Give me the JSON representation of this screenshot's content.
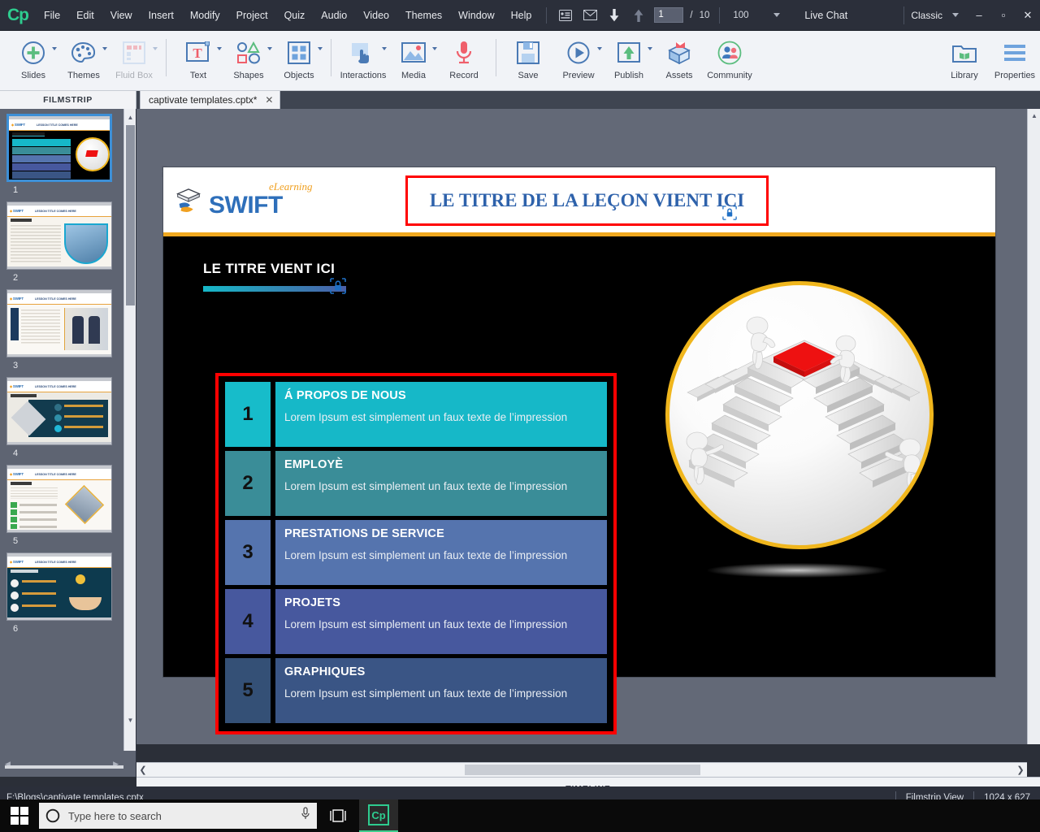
{
  "app": {
    "logo": "Cp",
    "menu_items": [
      "File",
      "Edit",
      "View",
      "Insert",
      "Modify",
      "Project",
      "Quiz",
      "Audio",
      "Video",
      "Themes",
      "Window",
      "Help"
    ],
    "slide_current": "1",
    "slide_separator": "/",
    "slide_total": "10",
    "zoom_level": "100",
    "live_chat": "Live Chat",
    "workspace": "Classic",
    "window_controls": {
      "minimize": "–",
      "maximize": "▫",
      "close": "✕"
    }
  },
  "ribbon": {
    "groups": [
      {
        "label": "Slides",
        "icon": "add-slide-icon",
        "has_chevron": true,
        "disabled": false
      },
      {
        "label": "Themes",
        "icon": "palette-icon",
        "has_chevron": true,
        "disabled": false
      },
      {
        "label": "Fluid Box",
        "icon": "fluidbox-icon",
        "has_chevron": true,
        "disabled": true
      },
      {
        "label": "Text",
        "icon": "text-icon",
        "has_chevron": true,
        "disabled": false
      },
      {
        "label": "Shapes",
        "icon": "shapes-icon",
        "has_chevron": true,
        "disabled": false
      },
      {
        "label": "Objects",
        "icon": "objects-icon",
        "has_chevron": true,
        "disabled": false
      },
      {
        "label": "Interactions",
        "icon": "interactions-icon",
        "has_chevron": true,
        "disabled": false
      },
      {
        "label": "Media",
        "icon": "media-icon",
        "has_chevron": true,
        "disabled": false
      },
      {
        "label": "Record",
        "icon": "record-icon",
        "has_chevron": false,
        "disabled": false
      },
      {
        "label": "Save",
        "icon": "save-icon",
        "has_chevron": false,
        "disabled": false
      },
      {
        "label": "Preview",
        "icon": "preview-icon",
        "has_chevron": true,
        "disabled": false
      },
      {
        "label": "Publish",
        "icon": "publish-icon",
        "has_chevron": true,
        "disabled": false
      },
      {
        "label": "Assets",
        "icon": "assets-icon",
        "has_chevron": false,
        "disabled": false
      },
      {
        "label": "Community",
        "icon": "community-icon",
        "has_chevron": false,
        "disabled": false
      },
      {
        "label": "Library",
        "icon": "library-icon",
        "has_chevron": false,
        "disabled": false
      },
      {
        "label": "Properties",
        "icon": "properties-icon",
        "has_chevron": false,
        "disabled": false
      }
    ]
  },
  "panels": {
    "filmstrip_label": "FILMSTRIP",
    "document_tab": "captivate templates.cptx*",
    "document_tab_close": "✕",
    "timeline_label": "TIMELINE"
  },
  "filmstrip": {
    "slides": [
      {
        "number": "1",
        "selected": true,
        "kind": "dark-list"
      },
      {
        "number": "2",
        "selected": false,
        "kind": "text-photo"
      },
      {
        "number": "3",
        "selected": false,
        "kind": "handshake"
      },
      {
        "number": "4",
        "selected": false,
        "kind": "diamond-dark"
      },
      {
        "number": "5",
        "selected": false,
        "kind": "checklist"
      },
      {
        "number": "6",
        "selected": false,
        "kind": "coins-dark"
      }
    ]
  },
  "slide": {
    "brand": {
      "name": "SWIFT",
      "tagline": "eLearning"
    },
    "lesson_title": "LE TITRE DE LA LEÇON VIENT ICI",
    "section_title": "LE TITRE VIENT ICI",
    "lock_icon": "lock-icon",
    "items": [
      {
        "number": "1",
        "heading": "Á PROPOS DE NOUS",
        "body": "Lorem Ipsum est simplement un faux texte de l’impression",
        "color": "#16b8c8",
        "num_color": "#17bcca"
      },
      {
        "number": "2",
        "heading": "EMPLOYÈ",
        "body": "Lorem Ipsum est simplement un faux texte de l’impression",
        "color": "#3a8d98",
        "num_color": "#3a8d98"
      },
      {
        "number": "3",
        "heading": "PRESTATIONS DE SERVICE",
        "body": "Lorem Ipsum est simplement un faux texte de l’impression",
        "color": "#5574ae",
        "num_color": "#5574ae"
      },
      {
        "number": "4",
        "heading": "PROJETS",
        "body": "Lorem Ipsum est simplement un faux texte de l’impression",
        "color": "#47589e",
        "num_color": "#47589e"
      },
      {
        "number": "5",
        "heading": "GRAPHIQUES",
        "body": "Lorem Ipsum est simplement un faux texte de l’impression",
        "color": "#3a5585",
        "num_color": "#345076"
      }
    ],
    "illustration": "stairs-to-red-platform-illustration",
    "selection_color": "#ff0000",
    "accent_gold": "#f0a81f"
  },
  "status": {
    "file_path": "F:\\Blogs\\captivate templates.cptx",
    "view_mode": "Filmstrip View",
    "dimensions": "1024 x 627"
  },
  "taskbar": {
    "start_icon": "windows-start-icon",
    "search_placeholder": "Type here to search",
    "search_icon": "cortana-circle-icon",
    "mic_icon": "microphone-icon",
    "taskview_icon": "task-view-icon",
    "app_icon": "captivate-icon",
    "app_icon_label": "Cp"
  }
}
